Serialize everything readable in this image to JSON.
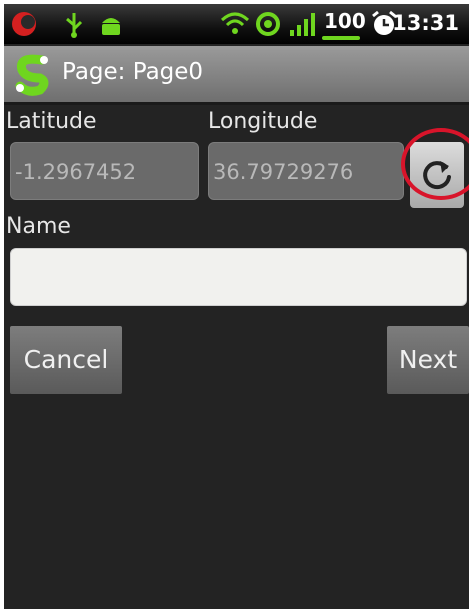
{
  "status_bar": {
    "battery_level": "100",
    "time": "13:31",
    "icons": [
      "notification-icon",
      "usb-icon",
      "android-debug-icon",
      "wifi-icon",
      "sync-icon",
      "signal-icon",
      "battery-icon",
      "alarm-icon"
    ],
    "battery_color": "#6fd61f"
  },
  "title_bar": {
    "title": "Page: Page0",
    "logo_icon": "app-logo-icon"
  },
  "form": {
    "latitude": {
      "label": "Latitude",
      "value": "-1.2967452"
    },
    "longitude": {
      "label": "Longitude",
      "value": "36.79729276"
    },
    "refresh_icon": "refresh-icon",
    "name": {
      "label": "Name",
      "value": ""
    }
  },
  "buttons": {
    "cancel": "Cancel",
    "next": "Next"
  },
  "colors": {
    "background": "#232323",
    "highlight": "#d8142a"
  }
}
